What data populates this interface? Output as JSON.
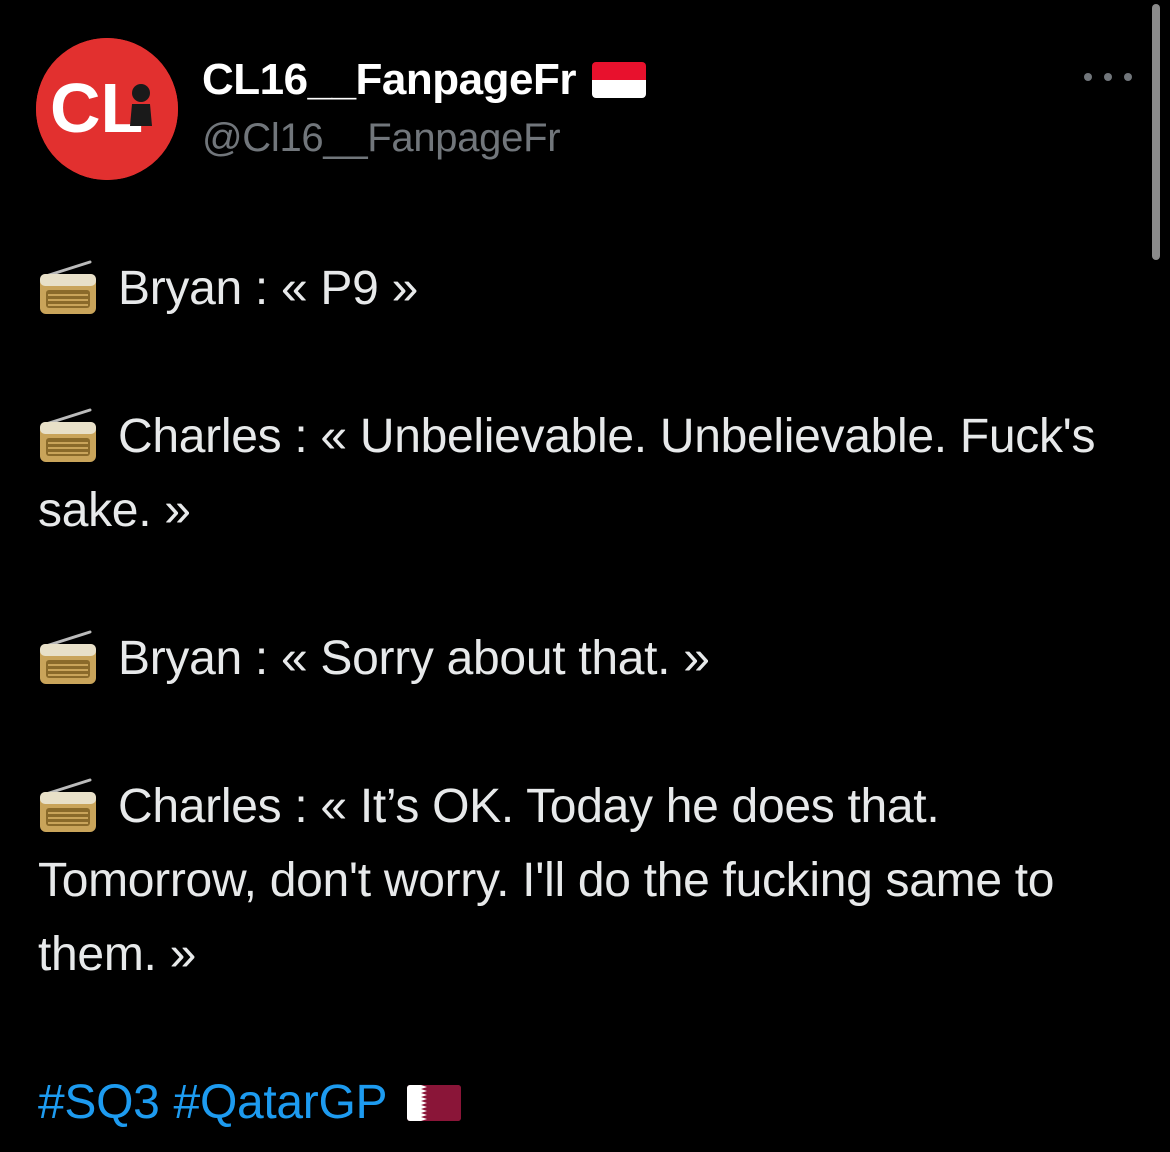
{
  "tweet": {
    "display_name": "CL16__FanpageFr",
    "handle": "@Cl16__FanpageFr",
    "avatar_text": "CL",
    "name_flag_icon": "monaco-flag-icon",
    "more_icon": "more-horizontal-icon",
    "paragraphs": [
      {
        "icon": "radio-icon",
        "text": "Bryan : « P9 »"
      },
      {
        "icon": "radio-icon",
        "text": "Charles : « Unbelievable. Unbelievable. Fuck's sake. »"
      },
      {
        "icon": "radio-icon",
        "text": "Bryan : « Sorry about that. »"
      },
      {
        "icon": "radio-icon",
        "text": "Charles : « It’s OK. Today he does that. Tomorrow, don't worry. I'll do the fucking same to them. »"
      }
    ],
    "hashtags": [
      "#SQ3",
      "#QatarGP"
    ],
    "hashtag_flag_icon": "qatar-flag-icon"
  },
  "colors": {
    "background": "#000000",
    "text": "#e7e9ea",
    "secondary_text": "#71767b",
    "link": "#1d9bf0",
    "avatar_bg": "#e2302f"
  }
}
